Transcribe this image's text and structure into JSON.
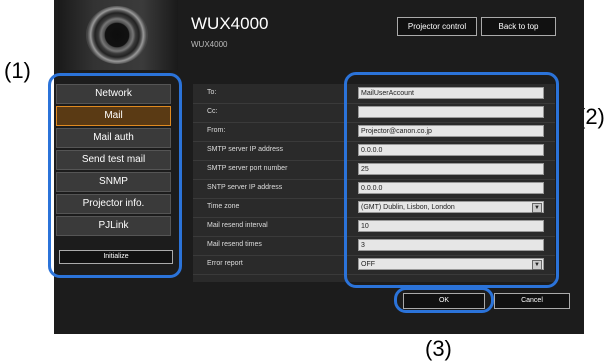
{
  "callouts": {
    "c1": "(1)",
    "c2": "(2)",
    "c3": "(3)"
  },
  "header": {
    "title": "WUX4000",
    "subtitle": "WUX4000",
    "projector_control": "Projector control",
    "back_to_top": "Back to top"
  },
  "sidebar": {
    "items": [
      {
        "label": "Network",
        "active": false
      },
      {
        "label": "Mail",
        "active": true
      },
      {
        "label": "Mail auth",
        "active": false
      },
      {
        "label": "Send test mail",
        "active": false
      },
      {
        "label": "SNMP",
        "active": false
      },
      {
        "label": "Projector info.",
        "active": false
      },
      {
        "label": "PJLink",
        "active": false
      }
    ],
    "initialize": "Initialize"
  },
  "form": {
    "rows": [
      {
        "label": "To:",
        "value": "MailUserAccount"
      },
      {
        "label": "Cc:",
        "value": ""
      },
      {
        "label": "From:",
        "value": "Projector@canon.co.jp"
      },
      {
        "label": "SMTP server IP address",
        "value": "0.0.0.0"
      },
      {
        "label": "SMTP server port number",
        "value": "25"
      },
      {
        "label": "SNTP server IP address",
        "value": "0.0.0.0"
      },
      {
        "label": "Time zone",
        "value": "(GMT) Dublin, Lisbon, London"
      },
      {
        "label": "Mail resend interval",
        "value": "10"
      },
      {
        "label": "Mail resend times",
        "value": "3"
      },
      {
        "label": "Error report",
        "value": "OFF"
      }
    ],
    "ok": "OK",
    "cancel": "Cancel"
  },
  "colors": {
    "highlight": "#2b73d9",
    "active_border": "#e08a20",
    "background": "#1c1c1c"
  }
}
